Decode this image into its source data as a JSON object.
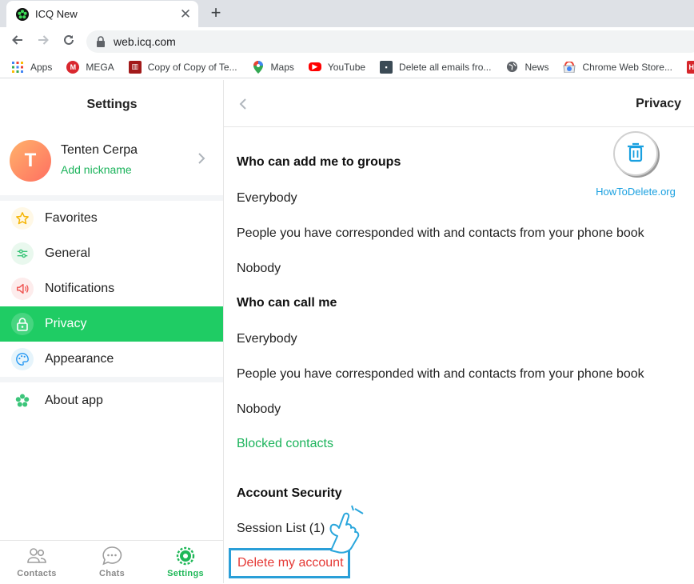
{
  "browser": {
    "tab_title": "ICQ New",
    "tab_close": "✕",
    "new_tab": "+",
    "url": "web.icq.com",
    "bookmarks": [
      {
        "label": "Apps",
        "icon": "apps-grid-icon"
      },
      {
        "label": "MEGA",
        "icon": "mega-icon",
        "color": "#d9272e"
      },
      {
        "label": "Copy of Copy of Te...",
        "icon": "doc-icon",
        "color": "#a21a1a"
      },
      {
        "label": "Maps",
        "icon": "maps-pin-icon"
      },
      {
        "label": "YouTube",
        "icon": "youtube-icon",
        "color": "#ff0000"
      },
      {
        "label": "Delete all emails fro...",
        "icon": "generic-page-icon",
        "color": "#3b4a55"
      },
      {
        "label": "News",
        "icon": "globe-icon"
      },
      {
        "label": "Chrome Web Store...",
        "icon": "chrome-store-icon"
      },
      {
        "label": "HC",
        "icon": "hc-icon",
        "color": "#d6262b"
      }
    ]
  },
  "sidebar": {
    "title": "Settings",
    "profile": {
      "initial": "T",
      "name": "Tenten Cerpa",
      "nickname": "Add nickname"
    },
    "items": [
      {
        "label": "Favorites",
        "icon": "star-icon"
      },
      {
        "label": "General",
        "icon": "sliders-icon"
      },
      {
        "label": "Notifications",
        "icon": "speaker-icon"
      },
      {
        "label": "Privacy",
        "icon": "lock-icon",
        "active": true
      },
      {
        "label": "Appearance",
        "icon": "palette-icon"
      },
      {
        "label": "About app",
        "icon": "icq-flower-icon"
      }
    ],
    "bottom_nav": [
      {
        "label": "Contacts",
        "icon": "contacts-icon"
      },
      {
        "label": "Chats",
        "icon": "chat-bubble-icon"
      },
      {
        "label": "Settings",
        "icon": "settings-gear-icon",
        "active": true
      }
    ]
  },
  "content": {
    "title": "Privacy",
    "groups_section": {
      "title": "Who can add me to groups",
      "options": [
        "Everybody",
        "People you have corresponded with and contacts from your phone book",
        "Nobody"
      ]
    },
    "call_section": {
      "title": "Who can call me",
      "options": [
        "Everybody",
        "People you have corresponded with and contacts from your phone book",
        "Nobody"
      ]
    },
    "blocked_contacts": "Blocked contacts",
    "account_security": {
      "title": "Account Security",
      "session_list": "Session List (1)",
      "delete_account": "Delete my account"
    },
    "watermark": "HowToDelete.org"
  },
  "colors": {
    "accent_green": "#1fcc64",
    "link_green": "#1bb35b",
    "danger_red": "#e53935",
    "highlight_blue": "#2a9fd8"
  }
}
